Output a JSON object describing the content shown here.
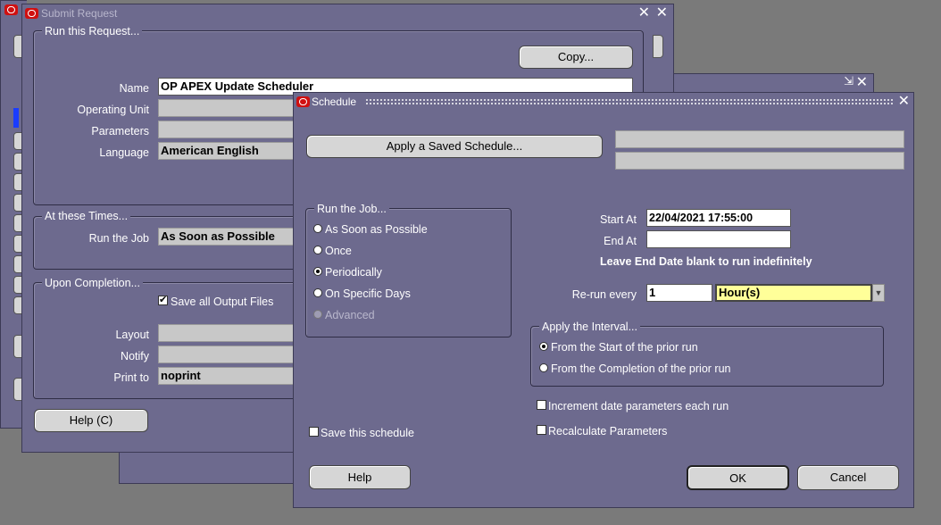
{
  "back_window": {
    "title": "Submit Request"
  },
  "submit_request": {
    "title": "Submit Request",
    "run_this_request": {
      "frame_label": "Run this Request...",
      "copy_button": "Copy...",
      "name_label": "Name",
      "name_value": "OP APEX Update Scheduler",
      "operating_unit_label": "Operating Unit",
      "parameters_label": "Parameters",
      "language_label": "Language",
      "language_value": "American English"
    },
    "at_these_times": {
      "frame_label": "At these Times...",
      "run_the_job_label": "Run the Job",
      "run_the_job_value": "As Soon as Possible"
    },
    "upon_completion": {
      "frame_label": "Upon Completion...",
      "save_output_label": "Save all Output Files",
      "save_output_checked": "✔",
      "layout_label": "Layout",
      "notify_label": "Notify",
      "print_to_label": "Print to",
      "print_to_value": "noprint"
    },
    "help_button": "Help (C)"
  },
  "schedule": {
    "title": "Schedule",
    "apply_saved_schedule_button": "Apply a Saved Schedule...",
    "run_the_job": {
      "frame_label": "Run the Job...",
      "options": [
        {
          "label": "As Soon as Possible",
          "selected": false,
          "enabled": true
        },
        {
          "label": "Once",
          "selected": false,
          "enabled": true
        },
        {
          "label": "Periodically",
          "selected": true,
          "enabled": true
        },
        {
          "label": "On Specific Days",
          "selected": false,
          "enabled": true
        },
        {
          "label": "Advanced",
          "selected": false,
          "enabled": false
        }
      ]
    },
    "start_at_label": "Start At",
    "start_at_value": "22/04/2021 17:55:00",
    "end_at_label": "End At",
    "end_at_value": "",
    "end_date_hint": "Leave End Date blank to run indefinitely",
    "rerun_every_label": "Re-run every",
    "rerun_every_value": "1",
    "rerun_unit_value": "Hour(s)",
    "apply_interval": {
      "frame_label": "Apply the Interval...",
      "options": [
        {
          "label": "From the Start of the prior run",
          "selected": true
        },
        {
          "label": "From the Completion of the prior run",
          "selected": false
        }
      ]
    },
    "increment_date_label": "Increment date parameters each run",
    "recalculate_label": "Recalculate Parameters",
    "save_schedule_label": "Save this schedule",
    "help_button": "Help",
    "ok_button": "OK",
    "cancel_button": "Cancel"
  },
  "colors": {
    "window_bg": "#6d6a8e",
    "desktop_bg": "#7a7a7a",
    "field_bg": "#c8c8c8",
    "input_bg": "#ffffff",
    "selected_input_bg": "#ffff99",
    "oracle_icon": "#d01010"
  }
}
